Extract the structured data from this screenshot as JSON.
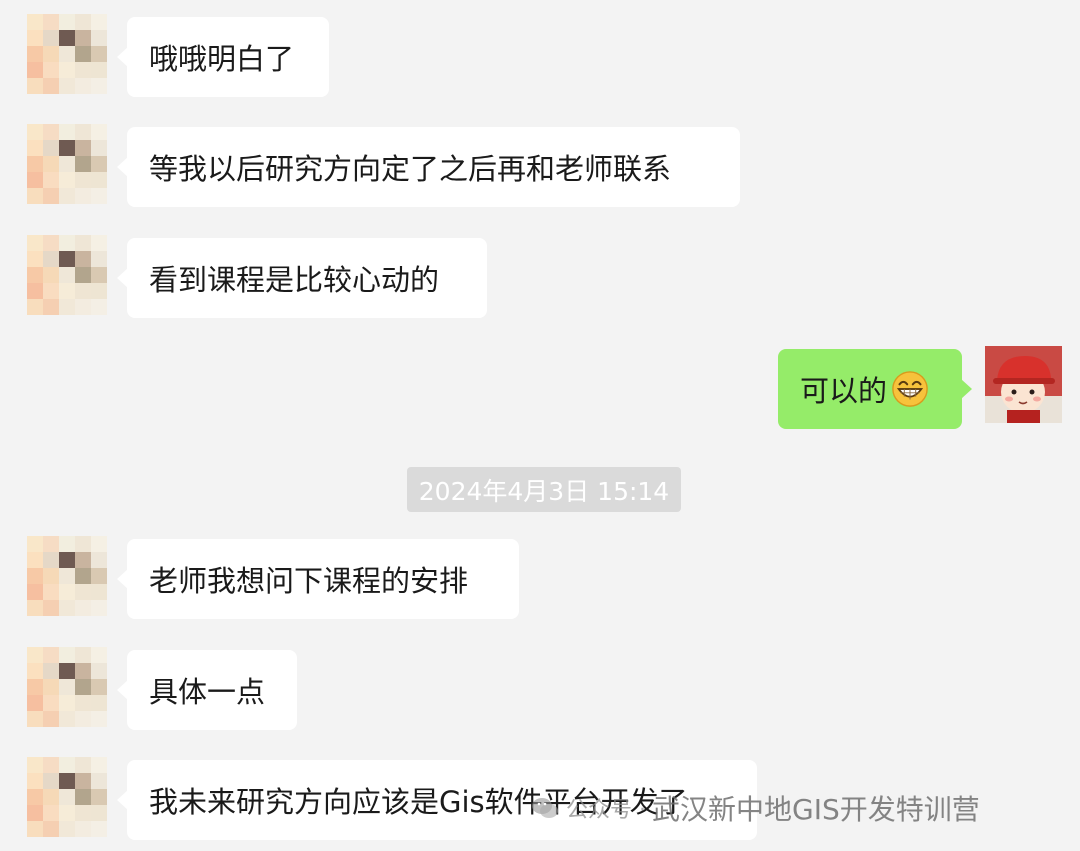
{
  "messages": [
    {
      "side": "in",
      "text": "哦哦明白了"
    },
    {
      "side": "in",
      "text": "等我以后研究方向定了之后再和老师联系"
    },
    {
      "side": "in",
      "text": "看到课程是比较心动的"
    },
    {
      "side": "out",
      "text": "可以的",
      "emoji": "grinning-face-icon"
    },
    {
      "side": "in",
      "text": "老师我想问下课程的安排"
    },
    {
      "side": "in",
      "text": "具体一点"
    },
    {
      "side": "in",
      "text": "我未来研究方向应该是Gis软件平台开发了"
    }
  ],
  "timestamp": "2024年4月3日 15:14",
  "watermark": {
    "prefix": "公众号 ·",
    "name": "武汉新中地GIS开发特训营"
  },
  "colors": {
    "background": "#f3f3f3",
    "incoming_bubble": "#ffffff",
    "outgoing_bubble": "#95ec69",
    "timestamp_bg": "#dadada"
  }
}
